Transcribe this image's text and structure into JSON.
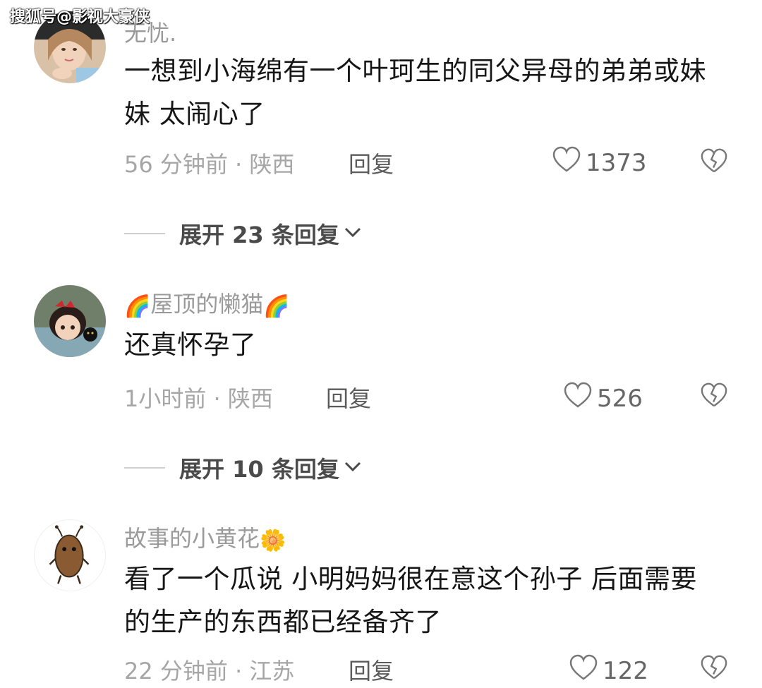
{
  "watermark": "搜狐号@影视大豪侠",
  "comments": [
    {
      "username": "无忧.",
      "username_emoji_left": "",
      "username_emoji_right": "",
      "text": "一想到小海绵有一个叶珂生的同父异母的弟弟或妹妹 太闹心了",
      "time_location": "56 分钟前 · 陕西",
      "reply_label": "回复",
      "likes": "1373",
      "expand_label": "展开 23 条回复"
    },
    {
      "username": "屋顶的懒猫",
      "username_emoji_left": "🌈",
      "username_emoji_right": "🌈",
      "text": "还真怀孕了",
      "time_location": "1小时前 · 陕西",
      "reply_label": "回复",
      "likes": "526",
      "expand_label": "展开 10 条回复"
    },
    {
      "username": "故事的小黄花",
      "username_emoji_left": "",
      "username_emoji_right": "🌼",
      "text": "看了一个瓜说 小明妈妈很在意这个孙子 后面需要的生产的东西都已经备齐了",
      "time_location": "22 分钟前 · 江苏",
      "reply_label": "回复",
      "likes": "122",
      "expand_label": ""
    }
  ],
  "colors": {
    "username": "#9a9a9a",
    "meta": "#a6a6a6",
    "body": "#161616",
    "expand": "#4a4a4a"
  }
}
